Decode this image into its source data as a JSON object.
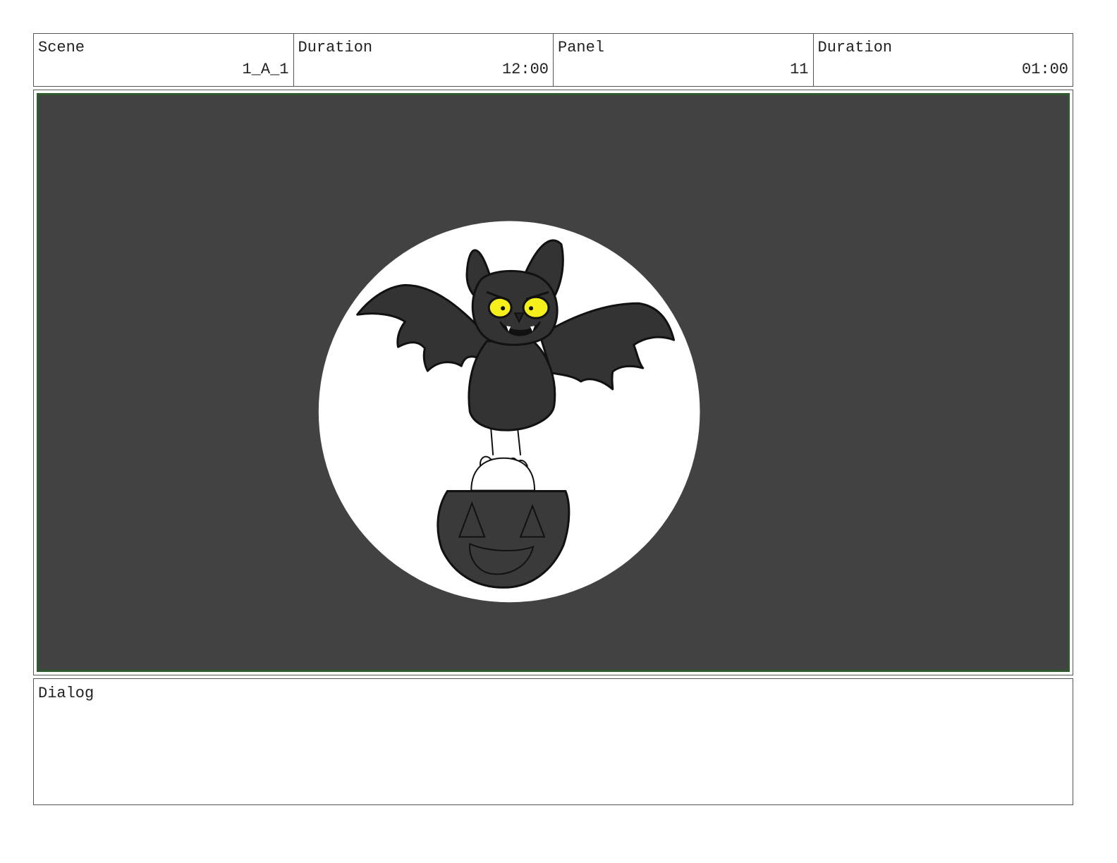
{
  "header": {
    "scene_label": "Scene",
    "scene_value": "1_A_1",
    "scene_duration_label": "Duration",
    "scene_duration_value": "12:00",
    "panel_label": "Panel",
    "panel_value": "11",
    "panel_duration_label": "Duration",
    "panel_duration_value": "01:00"
  },
  "dialog": {
    "label": "Dialog",
    "text": ""
  },
  "artwork": {
    "subject": "bat-holding-pumpkin-bucket-in-front-of-moon",
    "colors": {
      "background": "#424242",
      "frame_border": "#2e5a2e",
      "moon": "#ffffff",
      "bat_body": "#333333",
      "bat_eyes": "#f5ef1a",
      "pumpkin": "#3a3a3a"
    }
  }
}
